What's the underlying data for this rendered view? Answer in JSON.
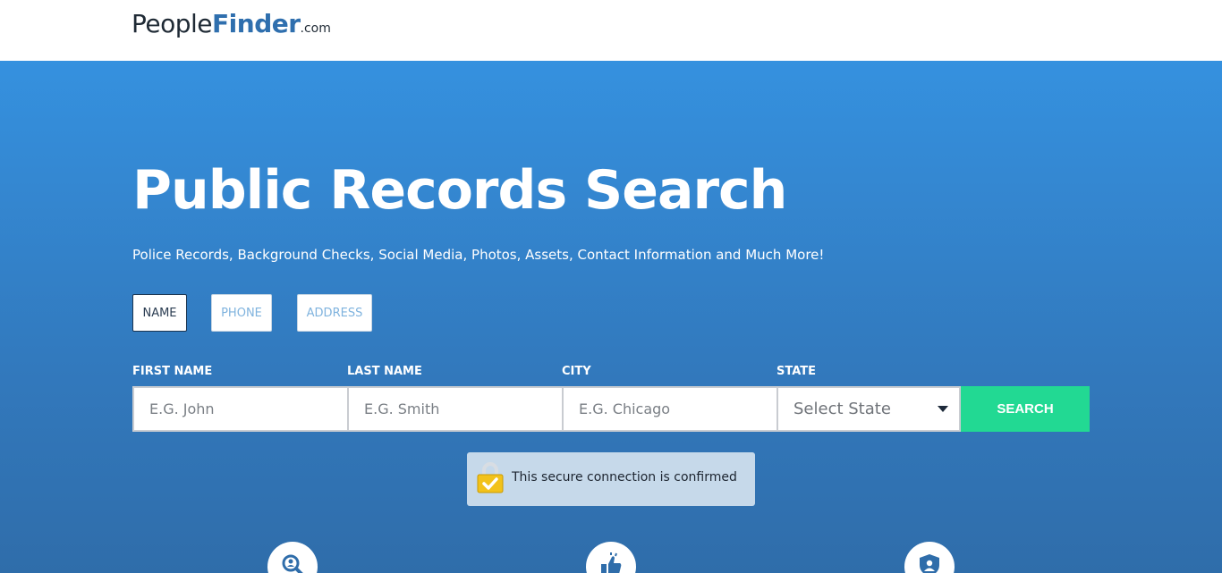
{
  "logo": {
    "people": "People",
    "finder": "Finder",
    "com": ".com"
  },
  "hero": {
    "title": "Public Records Search",
    "subtitle": "Police Records, Background Checks, Social Media, Photos, Assets, Contact Information and Much More!"
  },
  "tabs": [
    {
      "label": "NAME",
      "active": true
    },
    {
      "label": "PHONE",
      "active": false
    },
    {
      "label": "ADDRESS",
      "active": false
    }
  ],
  "form": {
    "first_name": {
      "label": "FIRST NAME",
      "placeholder": "E.G. John",
      "value": ""
    },
    "last_name": {
      "label": "LAST NAME",
      "placeholder": "E.G. Smith",
      "value": ""
    },
    "city": {
      "label": "CITY",
      "placeholder": "E.G. Chicago",
      "value": ""
    },
    "state": {
      "label": "STATE",
      "selected": "Select State"
    },
    "search_label": "SEARCH"
  },
  "secure_notice": {
    "text": "This secure connection is confirmed",
    "icon": "padlock-check-icon"
  },
  "features": [
    {
      "icon": "magnifier-person-icon"
    },
    {
      "icon": "thumbs-up-icon"
    },
    {
      "icon": "shield-user-icon"
    }
  ],
  "colors": {
    "brand_blue": "#2f6fae",
    "hero_top": "#3591df",
    "hero_bottom": "#2f6daa",
    "search_button": "#22d993",
    "secure_bg": "#c6d9ea"
  }
}
